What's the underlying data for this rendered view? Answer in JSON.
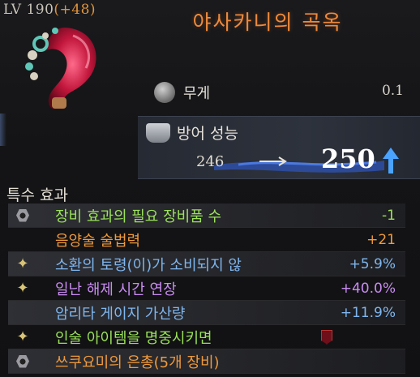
{
  "item": {
    "level_label": "LV 190",
    "level_bonus": "(+48)",
    "name": "야사카니의 곡옥"
  },
  "weight": {
    "label": "무게",
    "value": "0.1"
  },
  "defense": {
    "label": "방어 성능",
    "old_value": "246",
    "new_value": "250"
  },
  "section": {
    "title": "특수 효과"
  },
  "effects": [
    {
      "icon": "hex-gear-icon",
      "label": "장비 효과의 필요 장비품 수",
      "value": "-1",
      "color": "#9be25a",
      "shade": true
    },
    {
      "icon": "",
      "label": "음양술 술법력",
      "value": "+21",
      "color": "#ef9a3d",
      "shade": false
    },
    {
      "icon": "sparkle-icon",
      "label": "소환의 토령(이)가 소비되지 않",
      "value": "+5.9%",
      "color": "#7fb6ef",
      "shade": true
    },
    {
      "icon": "sparkle-icon",
      "label": "일난 해제 시간 연장",
      "value": "+40.0%",
      "color": "#c98cf2",
      "shade": false
    },
    {
      "icon": "",
      "label": "암리타 게이지 가산량",
      "value": "+11.9%",
      "color": "#7fb6ef",
      "shade": true
    },
    {
      "icon": "sparkle-icon",
      "label": "인술 아이템을 명중시키면",
      "value": "",
      "color": "#9be25a",
      "shade": false,
      "badge": true
    },
    {
      "icon": "hex-set-icon",
      "label": "쓰쿠요미의 은총(5개 장비)",
      "value": "",
      "color": "#ef9a3d",
      "shade": true
    }
  ]
}
